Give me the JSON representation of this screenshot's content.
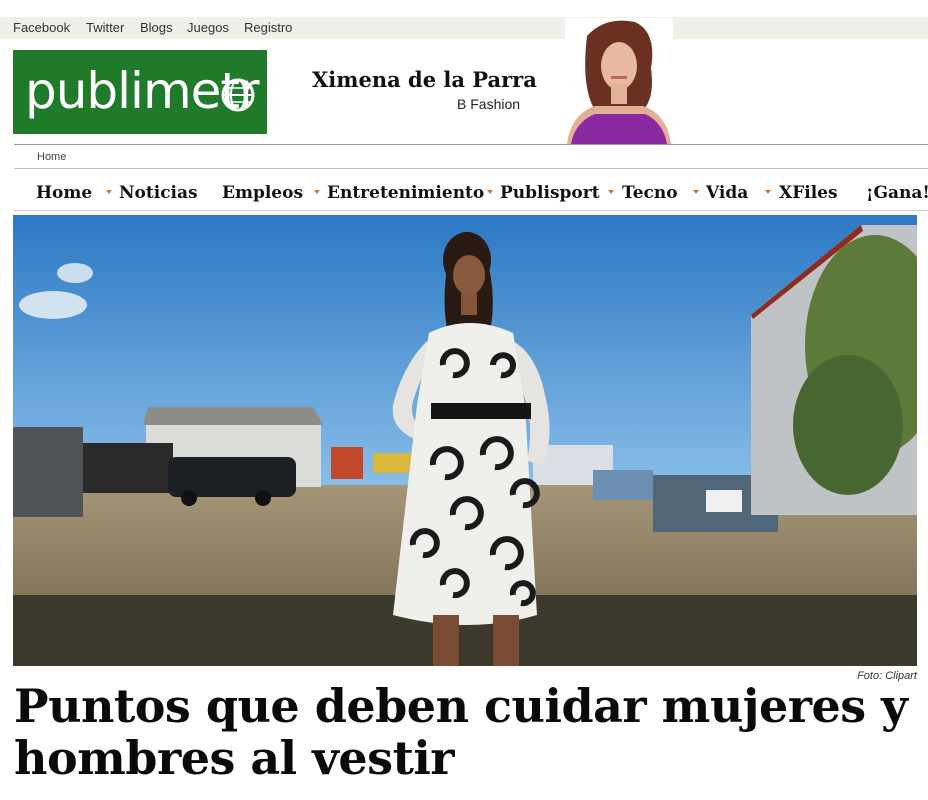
{
  "social_links": [
    "Facebook",
    "Twitter",
    "Blogs",
    "Juegos",
    "Registro"
  ],
  "logo": {
    "text": "publimetr",
    "bg_color": "#1f7a2a"
  },
  "author": {
    "name": "Ximena de la Parra",
    "blog": "B Fashion"
  },
  "breadcrumb": "Home",
  "nav": [
    {
      "label": "Home",
      "dropdown": false
    },
    {
      "label": "Noticias",
      "dropdown": true
    },
    {
      "label": "Empleos",
      "dropdown": false
    },
    {
      "label": "Entretenimiento",
      "dropdown": true
    },
    {
      "label": "Publisport",
      "dropdown": true
    },
    {
      "label": "Tecno",
      "dropdown": false
    },
    {
      "label": "Vida",
      "dropdown": true
    },
    {
      "label": "XFiles",
      "dropdown": true
    },
    {
      "label": "¡Gana!",
      "dropdown": false
    }
  ],
  "article": {
    "photo_credit": "Foto: Clipart",
    "headline": "Puntos que deben cuidar mujeres y hombres al vestir"
  },
  "colors": {
    "nav_arrow": "#e07020",
    "topbar_bg": "#f0efea"
  }
}
